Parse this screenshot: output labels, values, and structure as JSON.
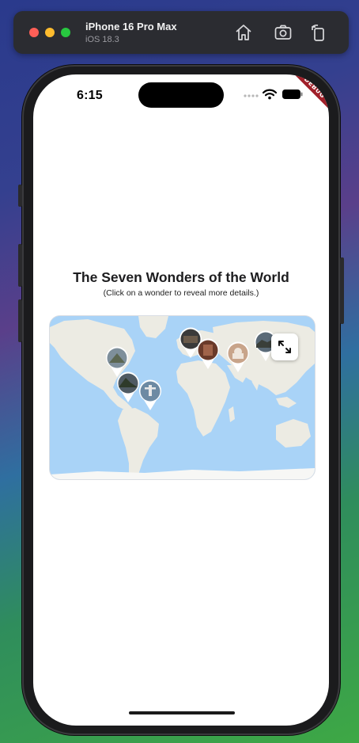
{
  "simulator": {
    "device_name": "iPhone 16 Pro Max",
    "os_version": "iOS 18.3",
    "icons": [
      "home-icon",
      "screenshot-icon",
      "rotate-icon"
    ]
  },
  "status_bar": {
    "time": "6:15",
    "icons": [
      "signal-dots-icon",
      "wifi-icon",
      "battery-icon"
    ]
  },
  "debug_banner": "DEBUG",
  "page": {
    "title": "The Seven Wonders of the World",
    "subtitle": "(Click on a wonder to reveal more details.)"
  },
  "map": {
    "expand_icon": "expand-icon",
    "markers": [
      {
        "name": "chichen-itza",
        "colors": [
          "#8a9aa6",
          "#5f6d55"
        ]
      },
      {
        "name": "machu-picchu",
        "colors": [
          "#4f5a63",
          "#2e3a2a"
        ]
      },
      {
        "name": "christ-the-redeemer",
        "colors": [
          "#6d8aa3",
          "#3b4c3a"
        ]
      },
      {
        "name": "colosseum",
        "colors": [
          "#3a3a3a",
          "#6a5a4a"
        ]
      },
      {
        "name": "petra",
        "colors": [
          "#6a3a2a",
          "#a0634a"
        ]
      },
      {
        "name": "taj-mahal",
        "colors": [
          "#c8a48a",
          "#8a6a50"
        ]
      },
      {
        "name": "great-wall",
        "colors": [
          "#5a6a78",
          "#3a3f3a"
        ]
      }
    ]
  },
  "colors": {
    "ocean": "#a9d3f7",
    "land": "#ecebe3",
    "debug": "#a1202a"
  }
}
